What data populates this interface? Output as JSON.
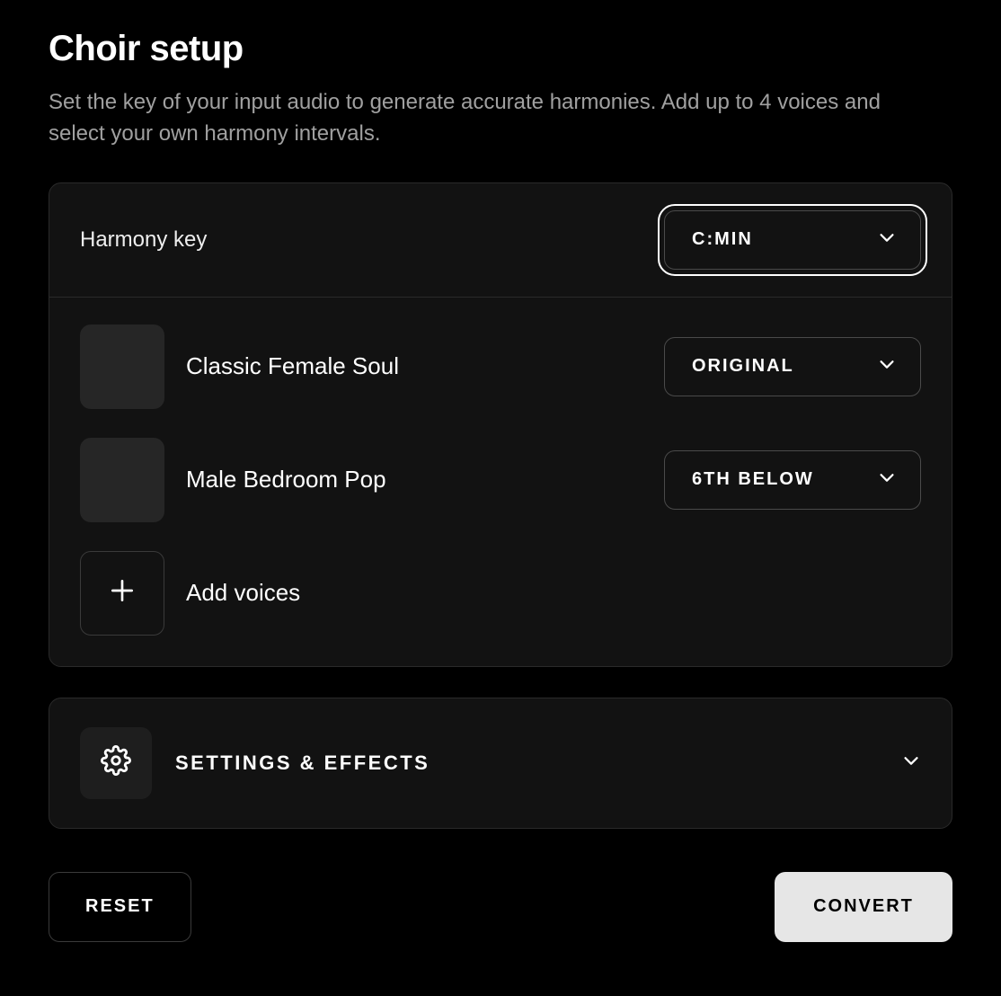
{
  "header": {
    "title": "Choir setup",
    "description": "Set the key of your input audio to generate accurate harmonies. Add up to 4 voices and select your own harmony intervals."
  },
  "harmony": {
    "label": "Harmony key",
    "value": "C:MIN"
  },
  "voices": [
    {
      "name": "Classic Female Soul",
      "interval": "ORIGINAL"
    },
    {
      "name": "Male Bedroom Pop",
      "interval": "6TH BELOW"
    }
  ],
  "addVoices": {
    "label": "Add voices"
  },
  "settings": {
    "label": "SETTINGS & EFFECTS"
  },
  "actions": {
    "reset": "RESET",
    "convert": "CONVERT"
  },
  "icons": {
    "chevron": "chevron-down-icon",
    "plus": "plus-icon",
    "gear": "gear-icon"
  }
}
